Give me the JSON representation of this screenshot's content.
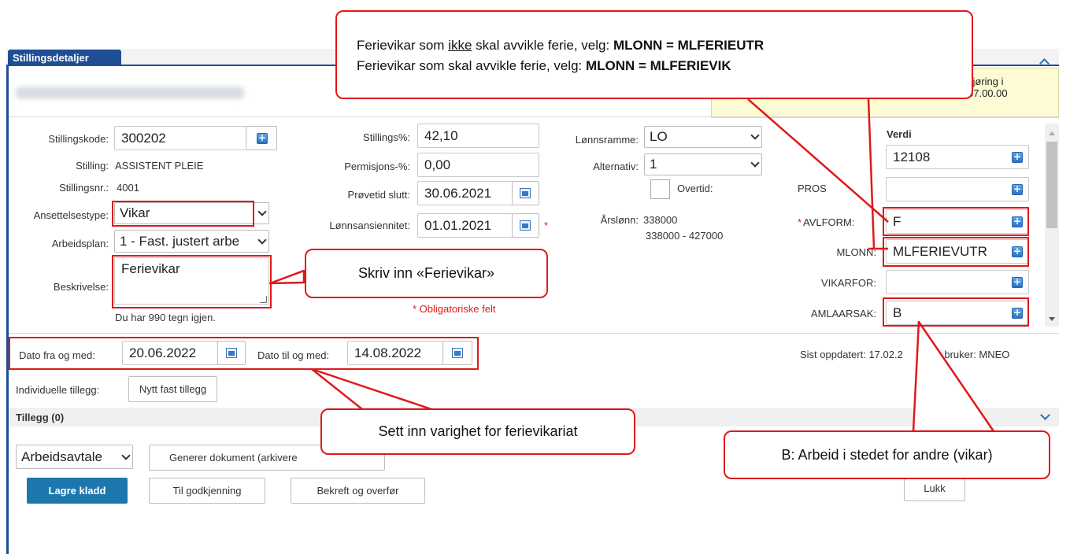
{
  "panel": {
    "tab_label": "Stillingsdetaljer",
    "info_text_line1": "kjøring i",
    "info_text_line2": "07.00.00"
  },
  "form": {
    "stillingskode": {
      "label": "Stillingskode:",
      "value": "300202"
    },
    "stilling": {
      "label": "Stilling:",
      "value": "ASSISTENT PLEIE"
    },
    "stillingsnr": {
      "label": "Stillingsnr.:",
      "value": "4001"
    },
    "ansettelsestype": {
      "label": "Ansettelsestype:",
      "value": "Vikar"
    },
    "arbeidsplan": {
      "label": "Arbeidsplan:",
      "value": "1 - Fast. justert arbe"
    },
    "beskrivelse": {
      "label": "Beskrivelse:",
      "value": "Ferievikar",
      "remaining": "Du har 990 tegn igjen."
    },
    "stillingsprosent": {
      "label": "Stillings%:",
      "value": "42,10"
    },
    "permisjonsprosent": {
      "label": "Permisjons-%:",
      "value": "0,00"
    },
    "provetid": {
      "label": "Prøvetid slutt:",
      "value": "30.06.2021"
    },
    "lonnsansiennitet": {
      "label": "Lønnsansiennitet:",
      "value": "01.01.2021",
      "required_mark": "*"
    },
    "obligatoriske": "* Obligatoriske felt",
    "lonnsramme": {
      "label": "Lønnsramme:",
      "value": "LO"
    },
    "alternativ": {
      "label": "Alternativ:",
      "value": "1"
    },
    "overtid": {
      "label": "Overtid:"
    },
    "arslonn": {
      "label": "Årslønn:",
      "value": "338000",
      "range": "338000 - 427000"
    },
    "dato_fra": {
      "label": "Dato fra og med:",
      "value": "20.06.2022"
    },
    "dato_til": {
      "label": "Dato til og med:",
      "value": "14.08.2022"
    },
    "individuelle_tillegg": "Individuelle tillegg:",
    "nytt_fast_tillegg": "Nytt fast tillegg",
    "sist_oppdatert": "Sist oppdatert: 17.02.2",
    "av_bruker": "av bruker: MNEO"
  },
  "verdi_table": {
    "header": "Verdi",
    "rows": [
      {
        "label": "",
        "value": "12108",
        "required": ""
      },
      {
        "label": "PROS",
        "value": "",
        "required": ""
      },
      {
        "label": "AVLFORM:",
        "value": "F",
        "required": "*"
      },
      {
        "label": "MLONN:",
        "value": "MLFERIEVUTR",
        "required": ""
      },
      {
        "label": "VIKARFOR:",
        "value": "",
        "required": ""
      },
      {
        "label": "AMLAARSAK:",
        "value": "B",
        "required": ""
      }
    ]
  },
  "tillegg": {
    "header": "Tillegg (0)"
  },
  "actions": {
    "arbeidsavtale": "Arbeidsavtale",
    "generer_dokument": "Generer dokument (arkivere",
    "lagre_kladd": "Lagre kladd",
    "til_godkjenning": "Til godkjenning",
    "bekreft": "Bekreft og overfør",
    "lukk": "Lukk"
  },
  "callouts": {
    "top_line1_a": "Ferievikar som ",
    "top_line1_u": "ikke",
    "top_line1_b": " skal avvikle ferie, velg: ",
    "top_line1_bold": "MLONN = MLFERIEUTR",
    "top_line2_a": "Ferievikar som skal avvikle ferie, velg: ",
    "top_line2_bold": "MLONN = MLFERIEVIK",
    "skriv_inn": "Skriv inn «Ferievikar»",
    "sett_inn": "Sett inn varighet for ferievikariat",
    "b_arbeid": "B: Arbeid i stedet for andre (vikar)"
  },
  "colors": {
    "accent": "#1f4e97",
    "primary_button": "#1d77ad",
    "annotation": "#e01919",
    "info_bg": "#fcfbd4"
  }
}
